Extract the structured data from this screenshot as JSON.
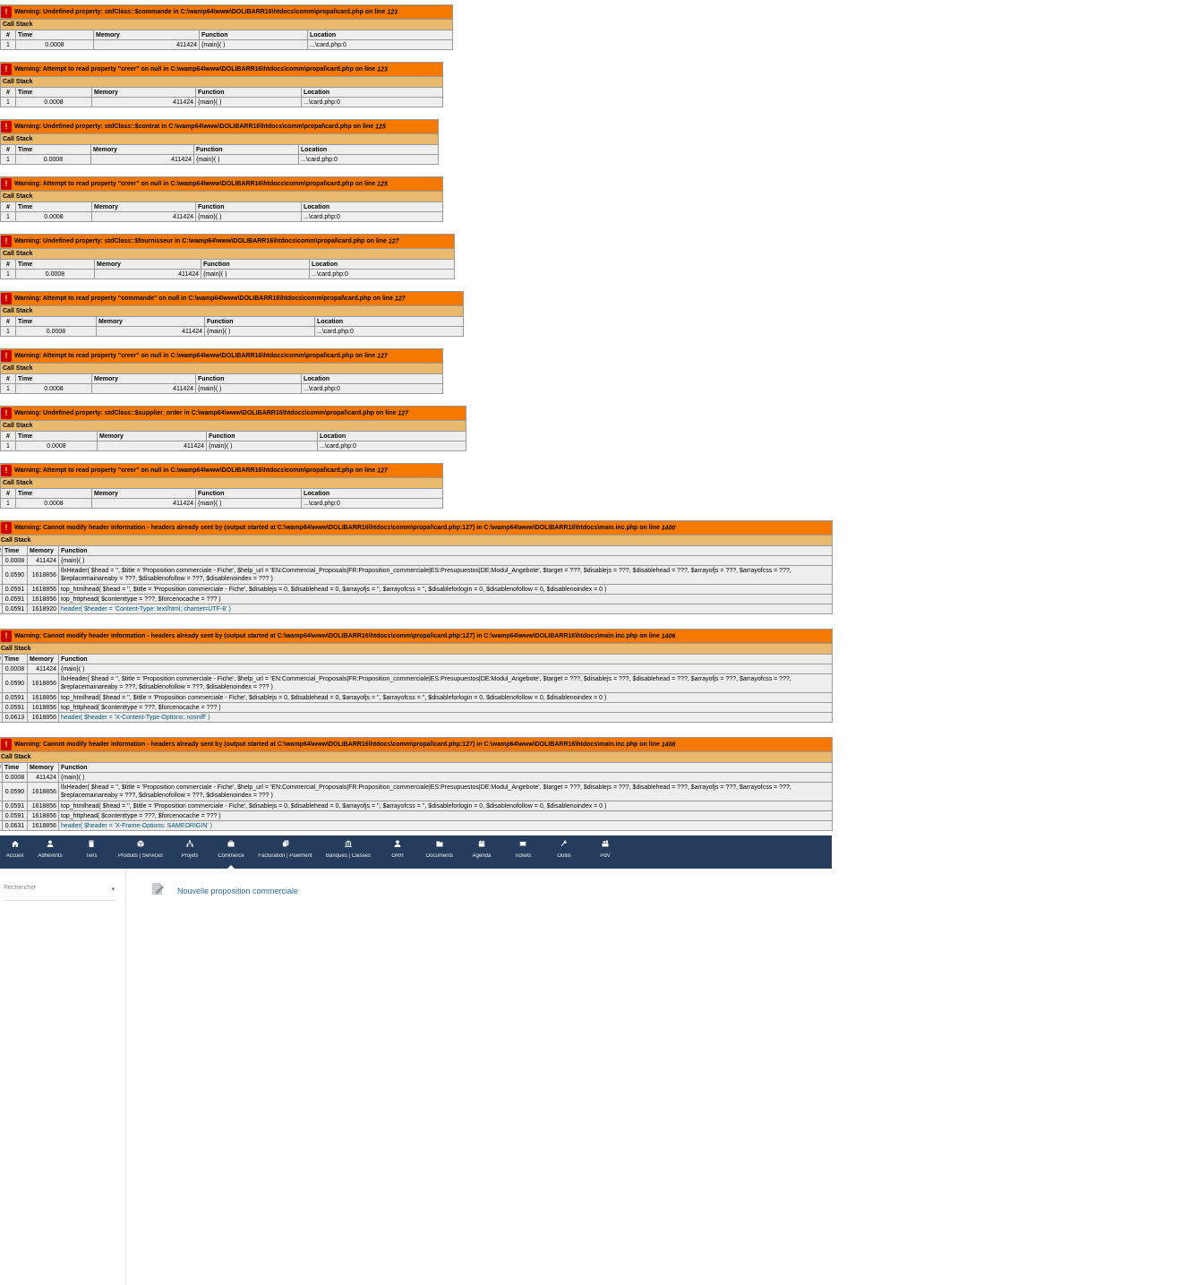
{
  "warnings_small": [
    {
      "message": "Warning: Undefined property: stdClass::$commande in C:\\wamp64\\www\\DOLIBARR16\\htdocs\\comm\\propal\\card.php on line ",
      "line": "123",
      "rows": [
        {
          "n": "1",
          "time": "0.0008",
          "memory": "411424",
          "function": "{main}( )",
          "location": "...\\card.php:0"
        }
      ]
    },
    {
      "message": "Warning: Attempt to read property \"creer\" on null in C:\\wamp64\\www\\DOLIBARR16\\htdocs\\comm\\propal\\card.php on line ",
      "line": "123",
      "rows": [
        {
          "n": "1",
          "time": "0.0008",
          "memory": "411424",
          "function": "{main}( )",
          "location": "...\\card.php:0"
        }
      ]
    },
    {
      "message": "Warning: Undefined property: stdClass::$contrat in C:\\wamp64\\www\\DOLIBARR16\\htdocs\\comm\\propal\\card.php on line ",
      "line": "125",
      "rows": [
        {
          "n": "1",
          "time": "0.0008",
          "memory": "411424",
          "function": "{main}( )",
          "location": "...\\card.php:0"
        }
      ]
    },
    {
      "message": "Warning: Attempt to read property \"creer\" on null in C:\\wamp64\\www\\DOLIBARR16\\htdocs\\comm\\propal\\card.php on line ",
      "line": "125",
      "rows": [
        {
          "n": "1",
          "time": "0.0008",
          "memory": "411424",
          "function": "{main}( )",
          "location": "...\\card.php:0"
        }
      ]
    },
    {
      "message": "Warning: Undefined property: stdClass::$fournisseur in C:\\wamp64\\www\\DOLIBARR16\\htdocs\\comm\\propal\\card.php on line ",
      "line": "127",
      "rows": [
        {
          "n": "1",
          "time": "0.0008",
          "memory": "411424",
          "function": "{main}( )",
          "location": "...\\card.php:0"
        }
      ]
    },
    {
      "message": "Warning: Attempt to read property \"commande\" on null in C:\\wamp64\\www\\DOLIBARR16\\htdocs\\comm\\propal\\card.php on line ",
      "line": "127",
      "rows": [
        {
          "n": "1",
          "time": "0.0008",
          "memory": "411424",
          "function": "{main}( )",
          "location": "...\\card.php:0"
        }
      ]
    },
    {
      "message": "Warning: Attempt to read property \"creer\" on null in C:\\wamp64\\www\\DOLIBARR16\\htdocs\\comm\\propal\\card.php on line ",
      "line": "127",
      "rows": [
        {
          "n": "1",
          "time": "0.0008",
          "memory": "411424",
          "function": "{main}( )",
          "location": "...\\card.php:0"
        }
      ]
    },
    {
      "message": "Warning: Undefined property: stdClass::$supplier_order in C:\\wamp64\\www\\DOLIBARR16\\htdocs\\comm\\propal\\card.php on line ",
      "line": "127",
      "rows": [
        {
          "n": "1",
          "time": "0.0008",
          "memory": "411424",
          "function": "{main}( )",
          "location": "...\\card.php:0"
        }
      ]
    },
    {
      "message": "Warning: Attempt to read property \"creer\" on null in C:\\wamp64\\www\\DOLIBARR16\\htdocs\\comm\\propal\\card.php on line ",
      "line": "127",
      "rows": [
        {
          "n": "1",
          "time": "0.0008",
          "memory": "411424",
          "function": "{main}( )",
          "location": "...\\card.php:0"
        }
      ]
    }
  ],
  "warnings_large": [
    {
      "message": "Warning: Cannot modify header information - headers already sent by (output started at C:\\wamp64\\www\\DOLIBARR16\\htdocs\\comm\\propal\\card.php:127) in C:\\wamp64\\www\\DOLIBARR16\\htdocs\\main.inc.php on line ",
      "line": "1400",
      "rows": [
        {
          "time": "0.0008",
          "memory": "411424",
          "function": "{main}( )"
        },
        {
          "time": "0.0590",
          "memory": "1618856",
          "function": "llxHeader( $head = '', $title = 'Proposition commerciale - Fiche', $help_url = 'EN:Commercial_Proposals|FR:Proposition_commerciale|ES:Presupuestos|DE:Modul_Angebote', $target = ???, $disablejs = ???, $disablehead = ???, $arrayofjs = ???, $arrayofcss = ???, $replacemainareaby = ???, $disablenofollow = ???, $disablenoindex = ??? )"
        },
        {
          "time": "0.0591",
          "memory": "1618856",
          "function": "top_htmlhead( $head = '', $title = 'Proposition commerciale - Fiche', $disablejs = 0, $disablehead = 0, $arrayofjs = '', $arrayofcss = '', $disableforlogin = 0, $disablenofollow = 0, $disablenoindex = 0 )"
        },
        {
          "time": "0.0591",
          "memory": "1618856",
          "function": "top_httphead( $contenttype = ???, $forcenocache = ??? )"
        },
        {
          "time": "0.0591",
          "memory": "1618920",
          "function": "header( $header = 'Content-Type: text/html; charset=UTF-8' )"
        }
      ]
    },
    {
      "message": "Warning: Cannot modify header information - headers already sent by (output started at C:\\wamp64\\www\\DOLIBARR16\\htdocs\\comm\\propal\\card.php:127) in C:\\wamp64\\www\\DOLIBARR16\\htdocs\\main.inc.php on line ",
      "line": "1406",
      "rows": [
        {
          "time": "0.0008",
          "memory": "411424",
          "function": "{main}( )"
        },
        {
          "time": "0.0590",
          "memory": "1618856",
          "function": "llxHeader( $head = '', $title = 'Proposition commerciale - Fiche', $help_url = 'EN:Commercial_Proposals|FR:Proposition_commerciale|ES:Presupuestos|DE:Modul_Angebote', $target = ???, $disablejs = ???, $disablehead = ???, $arrayofjs = ???, $arrayofcss = ???, $replacemainareaby = ???, $disablenofollow = ???, $disablenoindex = ??? )"
        },
        {
          "time": "0.0591",
          "memory": "1618856",
          "function": "top_htmlhead( $head = '', $title = 'Proposition commerciale - Fiche', $disablejs = 0, $disablehead = 0, $arrayofjs = '', $arrayofcss = '', $disableforlogin = 0, $disablenofollow = 0, $disablenoindex = 0 )"
        },
        {
          "time": "0.0591",
          "memory": "1618856",
          "function": "top_httphead( $contenttype = ???, $forcenocache = ??? )"
        },
        {
          "time": "0.0613",
          "memory": "1618856",
          "function": "header( $header = 'X-Content-Type-Options: nosniff' )"
        }
      ]
    },
    {
      "message": "Warning: Cannot modify header information - headers already sent by (output started at C:\\wamp64\\www\\DOLIBARR16\\htdocs\\comm\\propal\\card.php:127) in C:\\wamp64\\www\\DOLIBARR16\\htdocs\\main.inc.php on line ",
      "line": "1408",
      "rows": [
        {
          "time": "0.0008",
          "memory": "411424",
          "function": "{main}( )"
        },
        {
          "time": "0.0590",
          "memory": "1618856",
          "function": "llxHeader( $head = '', $title = 'Proposition commerciale - Fiche', $help_url = 'EN:Commercial_Proposals|FR:Proposition_commerciale|ES:Presupuestos|DE:Modul_Angebote', $target = ???, $disablejs = ???, $disablehead = ???, $arrayofjs = ???, $arrayofcss = ???, $replacemainareaby = ???, $disablenofollow = ???, $disablenoindex = ??? )"
        },
        {
          "time": "0.0591",
          "memory": "1618856",
          "function": "top_htmlhead( $head = '', $title = 'Proposition commerciale - Fiche', $disablejs = 0, $disablehead = 0, $arrayofjs = '', $arrayofcss = '', $disableforlogin = 0, $disablenofollow = 0, $disablenoindex = 0 )"
        },
        {
          "time": "0.0591",
          "memory": "1618856",
          "function": "top_httphead( $contenttype = ???, $forcenocache = ??? )"
        },
        {
          "time": "0.0631",
          "memory": "1618856",
          "function": "header( $header = 'X-Frame-Options: SAMEORIGIN' )"
        }
      ]
    }
  ],
  "labels": {
    "bang": "!",
    "call_stack": "Call Stack",
    "col_num": "#",
    "col_time": "Time",
    "col_memory": "Memory",
    "col_function": "Function",
    "col_location": "Location"
  },
  "nav": {
    "items": [
      {
        "label": "Accueil",
        "icon": "home-icon"
      },
      {
        "label": "Adhérents",
        "icon": "user-icon"
      },
      {
        "label": "Tiers",
        "icon": "building-icon"
      },
      {
        "label": "Produits | Services",
        "icon": "cube-icon"
      },
      {
        "label": "Projets",
        "icon": "sitemap-icon"
      },
      {
        "label": "Commerce",
        "icon": "briefcase-icon",
        "active": true
      },
      {
        "label": "Facturation | Paiement",
        "icon": "copy-icon"
      },
      {
        "label": "Banques | Caisses",
        "icon": "bank-icon"
      },
      {
        "label": "GRH",
        "icon": "user-tie-icon"
      },
      {
        "label": "Documents",
        "icon": "folder-icon"
      },
      {
        "label": "Agenda",
        "icon": "calendar-icon"
      },
      {
        "label": "Tickets",
        "icon": "ticket-icon"
      },
      {
        "label": "Outils",
        "icon": "wrench-icon"
      },
      {
        "label": "PdV",
        "icon": "cash-register-icon"
      }
    ],
    "colors": {
      "background": "#263c5c",
      "text": "#ffffff"
    }
  },
  "search": {
    "placeholder": "Rechercher"
  },
  "page": {
    "title": "Nouvelle proposition commerciale"
  },
  "colors": {
    "warning_title": "#f57900",
    "call_stack": "#e9b96e",
    "row_bg": "#eeeeec",
    "bang_bg": "#cc0000",
    "link": "#2e6e9a"
  }
}
